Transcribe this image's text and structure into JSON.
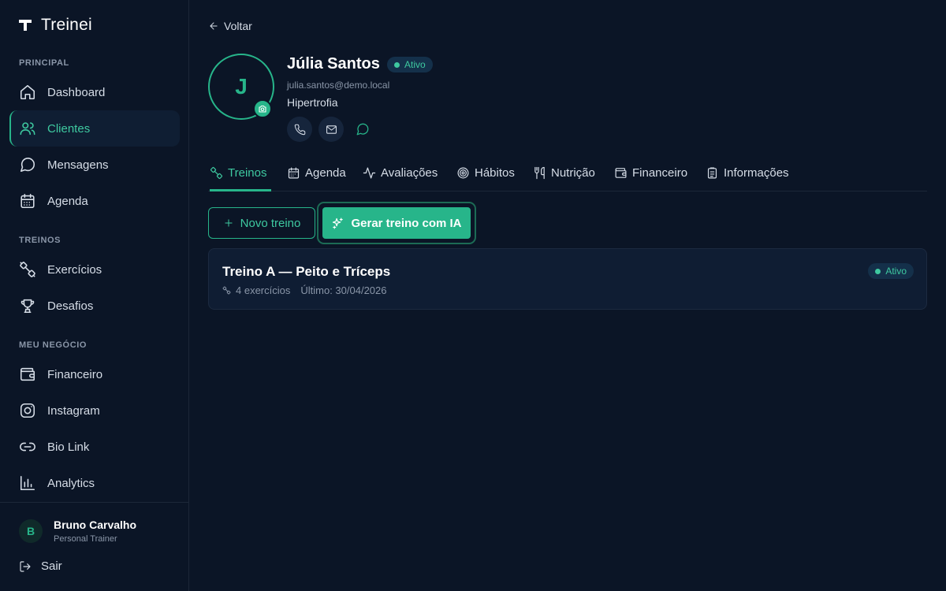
{
  "app": {
    "name": "Treinei"
  },
  "sidebar": {
    "sections": [
      {
        "label": "PRINCIPAL"
      },
      {
        "label": "TREINOS"
      },
      {
        "label": "MEU NEGÓCIO"
      }
    ],
    "items": [
      {
        "label": "Dashboard",
        "icon": "home-icon"
      },
      {
        "label": "Clientes",
        "icon": "users-icon",
        "active": true
      },
      {
        "label": "Mensagens",
        "icon": "message-circle-icon"
      },
      {
        "label": "Agenda",
        "icon": "calendar-icon"
      },
      {
        "label": "Exercícios",
        "icon": "dumbbell-icon"
      },
      {
        "label": "Desafios",
        "icon": "trophy-icon"
      },
      {
        "label": "Financeiro",
        "icon": "wallet-icon"
      },
      {
        "label": "Instagram",
        "icon": "instagram-icon"
      },
      {
        "label": "Bio Link",
        "icon": "link-icon"
      },
      {
        "label": "Analytics",
        "icon": "bar-chart-icon"
      }
    ],
    "user": {
      "initial": "B",
      "name": "Bruno Carvalho",
      "role": "Personal Trainer"
    },
    "logout_label": "Sair"
  },
  "header": {
    "back_label": "Voltar",
    "client": {
      "initial": "J",
      "name": "Júlia Santos",
      "status": "Ativo",
      "email": "julia.santos@demo.local",
      "goal": "Hipertrofia"
    }
  },
  "tabs": [
    {
      "label": "Treinos",
      "icon": "dumbbell-icon",
      "active": true
    },
    {
      "label": "Agenda",
      "icon": "calendar-icon"
    },
    {
      "label": "Avaliações",
      "icon": "activity-icon"
    },
    {
      "label": "Hábitos",
      "icon": "target-icon"
    },
    {
      "label": "Nutrição",
      "icon": "utensils-icon"
    },
    {
      "label": "Financeiro",
      "icon": "wallet-icon"
    },
    {
      "label": "Informações",
      "icon": "clipboard-icon"
    }
  ],
  "actions": {
    "new_workout_label": "Novo treino",
    "ai_workout_label": "Gerar treino com IA"
  },
  "workouts": [
    {
      "title": "Treino A — Peito e Tríceps",
      "exercises": "4 exercícios",
      "last": "Último: 30/04/2026",
      "status": "Ativo"
    }
  ],
  "colors": {
    "background": "#0b1526",
    "accent": "#27b58a",
    "accent_text": "#3ec9a0",
    "card": "#0f1d33"
  }
}
